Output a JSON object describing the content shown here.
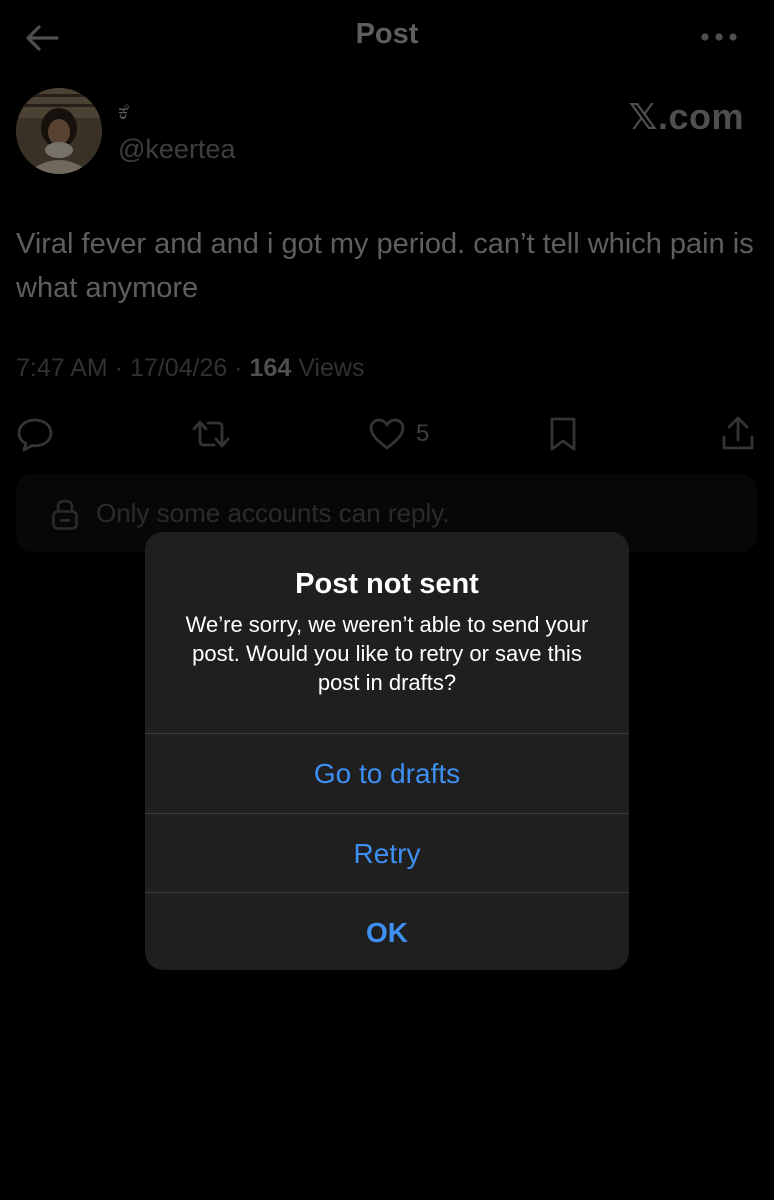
{
  "header": {
    "title": "Post",
    "back_icon": "arrow-left-icon",
    "more_icon": "more-dots-icon"
  },
  "author": {
    "display_name": "ಕೆ",
    "handle": "@keertea"
  },
  "watermark": "𝕏.com",
  "post": {
    "text": "Viral fever and and i got my period. can’t tell which pain is what anymore",
    "time": "7:47 AM",
    "date": "17/04/26",
    "separator": "·",
    "views_count": "164",
    "views_label": "Views"
  },
  "actions": {
    "like_count": "5"
  },
  "reply_restriction": "Only some accounts can reply.",
  "dialog": {
    "title": "Post not sent",
    "message": "We’re sorry, we weren’t able to send your post. Would you like to retry or save this post in drafts?",
    "go_to_drafts": "Go to drafts",
    "retry": "Retry",
    "ok": "OK"
  },
  "colors": {
    "background": "#000000",
    "dialog_bg": "#1f1f1f",
    "accent_blue": "#3e8ff2"
  }
}
